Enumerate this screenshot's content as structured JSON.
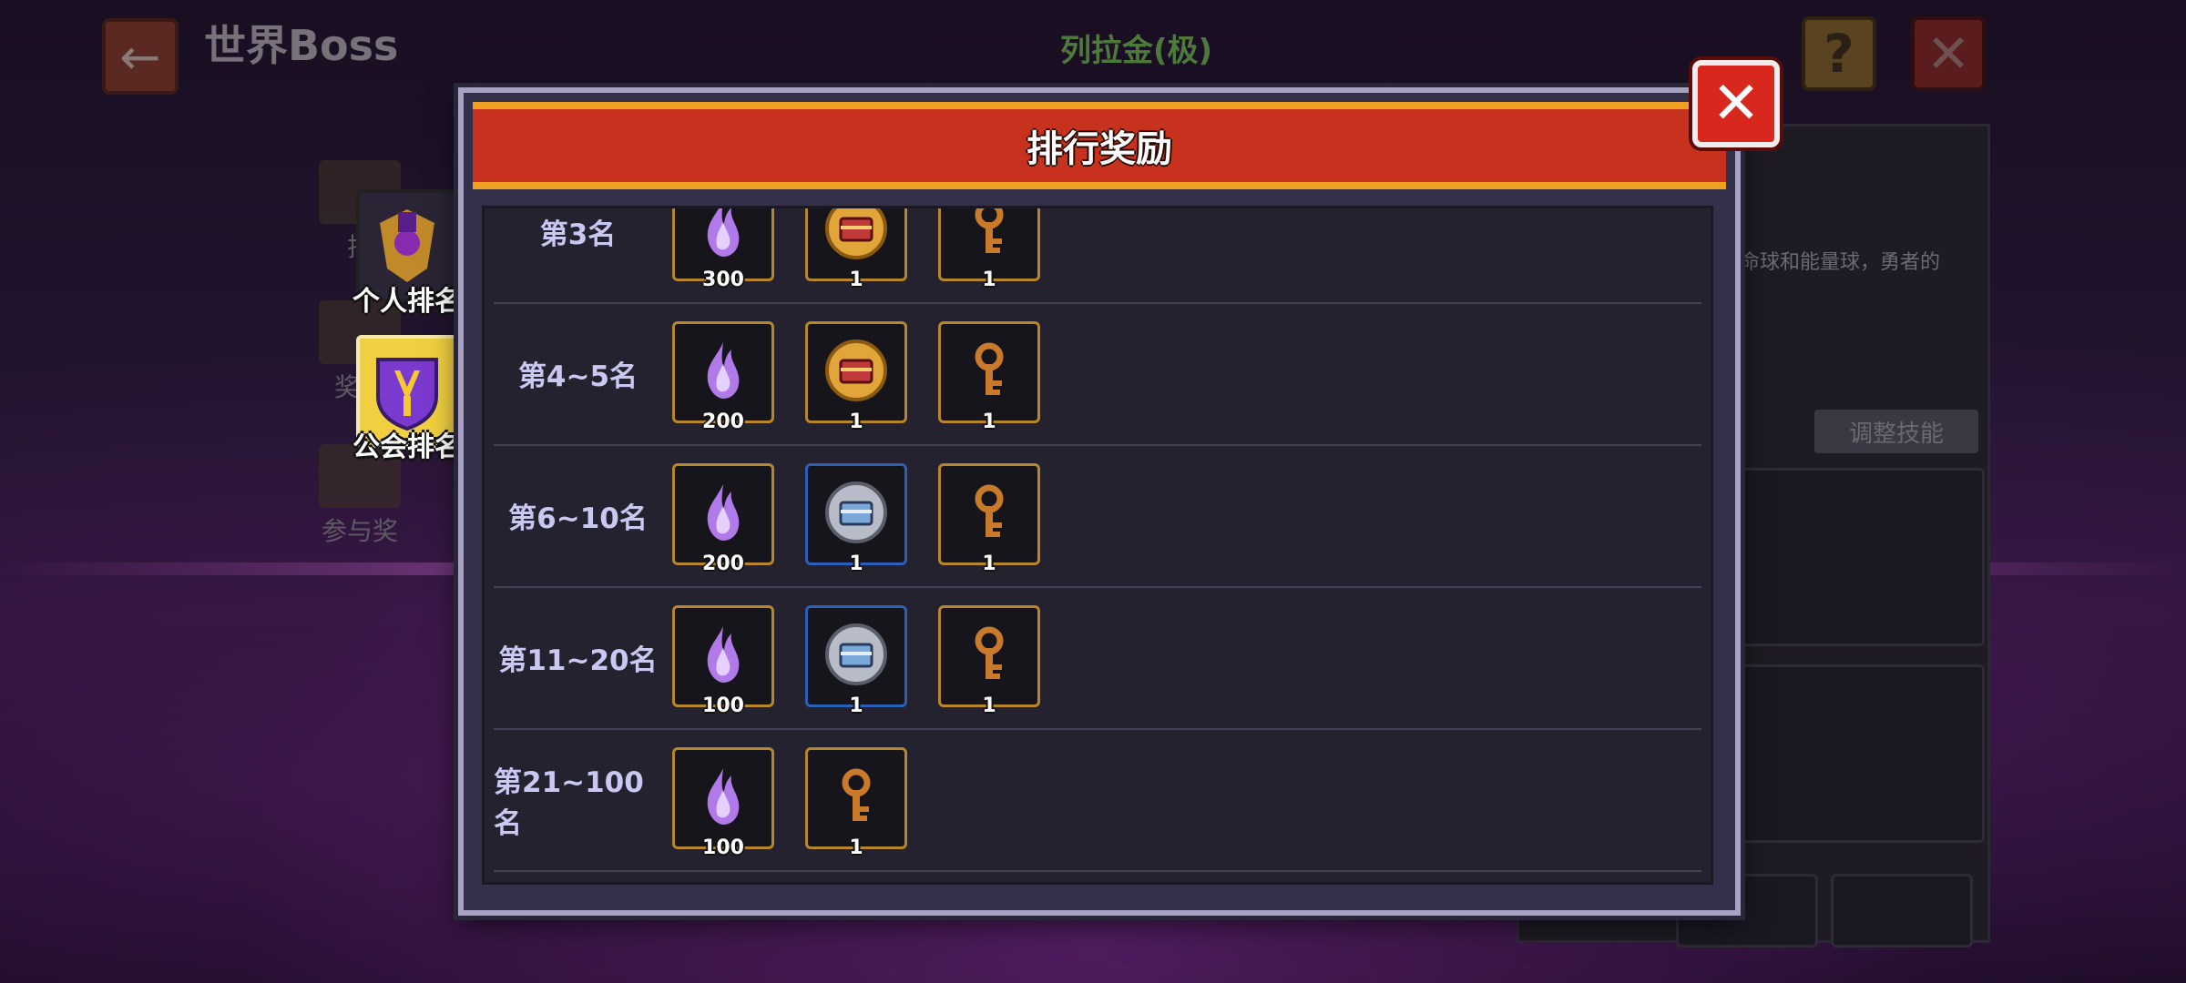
{
  "header": {
    "page_title": "世界Boss",
    "boss_name": "列拉金(极)",
    "help_label": "?",
    "close_label": "✕",
    "back_label": "←"
  },
  "left_menu": [
    {
      "label": "排",
      "icon": "trophy-icon"
    },
    {
      "label": "奖励",
      "icon": "chest-icon"
    },
    {
      "label": "参与奖",
      "icon": "gift-icon"
    }
  ],
  "tabs": [
    {
      "label": "个人排名",
      "icon": "personal-rank-icon",
      "active": false
    },
    {
      "label": "公会排名",
      "icon": "guild-shield-icon",
      "active": true
    }
  ],
  "right_panel": {
    "description": "命球和能量球，勇者的",
    "adjust_skill_label": "调整技能"
  },
  "modal": {
    "title": "排行奖励",
    "close_label": "✕",
    "rows": [
      {
        "rank": "第3名",
        "items": [
          {
            "icon": "purple-flame-icon",
            "qty": "300",
            "frame": "gold"
          },
          {
            "icon": "gold-chest-orb-icon",
            "qty": "1",
            "frame": "gold"
          },
          {
            "icon": "bronze-key-icon",
            "qty": "1",
            "frame": "gold"
          }
        ]
      },
      {
        "rank": "第4~5名",
        "items": [
          {
            "icon": "purple-flame-icon",
            "qty": "200",
            "frame": "gold"
          },
          {
            "icon": "gold-chest-orb-icon",
            "qty": "1",
            "frame": "gold"
          },
          {
            "icon": "bronze-key-icon",
            "qty": "1",
            "frame": "gold"
          }
        ]
      },
      {
        "rank": "第6~10名",
        "items": [
          {
            "icon": "purple-flame-icon",
            "qty": "200",
            "frame": "gold"
          },
          {
            "icon": "silver-chest-orb-icon",
            "qty": "1",
            "frame": "blue"
          },
          {
            "icon": "bronze-key-icon",
            "qty": "1",
            "frame": "gold"
          }
        ]
      },
      {
        "rank": "第11~20名",
        "items": [
          {
            "icon": "purple-flame-icon",
            "qty": "100",
            "frame": "gold"
          },
          {
            "icon": "silver-chest-orb-icon",
            "qty": "1",
            "frame": "blue"
          },
          {
            "icon": "bronze-key-icon",
            "qty": "1",
            "frame": "gold"
          }
        ]
      },
      {
        "rank": "第21~100名",
        "items": [
          {
            "icon": "purple-flame-icon",
            "qty": "100",
            "frame": "gold"
          },
          {
            "icon": "bronze-key-icon",
            "qty": "1",
            "frame": "gold"
          }
        ]
      }
    ]
  },
  "colors": {
    "header_red": "#c7321e",
    "header_trim": "#f0a020",
    "modal_bg": "#34304a",
    "rank_text": "#c8c8f0",
    "boss_name": "#4d7a3c"
  }
}
